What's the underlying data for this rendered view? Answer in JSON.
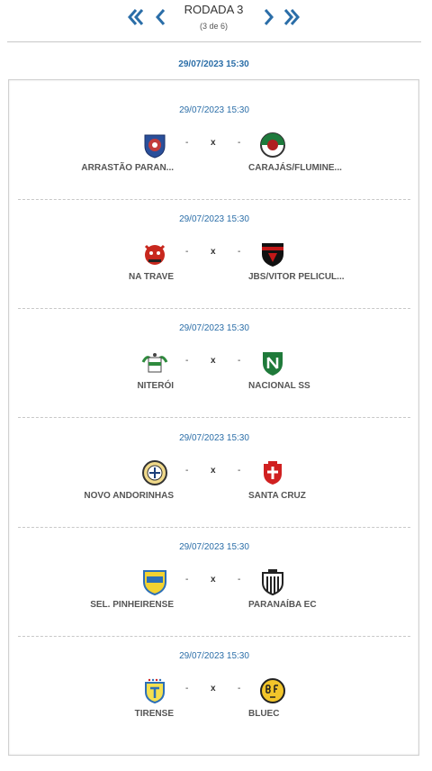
{
  "round": {
    "title": "RODADA 3",
    "subtitle": "(3 de 6)"
  },
  "nav": {
    "first": "double-chevron-left-icon",
    "prev": "chevron-left-icon",
    "next": "chevron-right-icon",
    "last": "double-chevron-right-icon"
  },
  "group_date": "29/07/2023 15:30",
  "colors": {
    "accent": "#2b6ea8"
  },
  "matches": [
    {
      "date": "29/07/2023 15:30",
      "home": "ARRASTÃO PARAN...",
      "away": "CARAJÁS/FLUMINE...",
      "home_score": "-",
      "away_score": "-",
      "vs": "x"
    },
    {
      "date": "29/07/2023 15:30",
      "home": "NA TRAVE",
      "away": "JBS/VITOR PELICUL...",
      "home_score": "-",
      "away_score": "-",
      "vs": "x"
    },
    {
      "date": "29/07/2023 15:30",
      "home": "NITERÓI",
      "away": "NACIONAL SS",
      "home_score": "-",
      "away_score": "-",
      "vs": "x"
    },
    {
      "date": "29/07/2023 15:30",
      "home": "NOVO ANDORINHAS",
      "away": "SANTA CRUZ",
      "home_score": "-",
      "away_score": "-",
      "vs": "x"
    },
    {
      "date": "29/07/2023 15:30",
      "home": "SEL. PINHEIRENSE",
      "away": "PARANAÍBA EC",
      "home_score": "-",
      "away_score": "-",
      "vs": "x"
    },
    {
      "date": "29/07/2023 15:30",
      "home": "TIRENSE",
      "away": "BLUEC",
      "home_score": "-",
      "away_score": "-",
      "vs": "x"
    }
  ]
}
